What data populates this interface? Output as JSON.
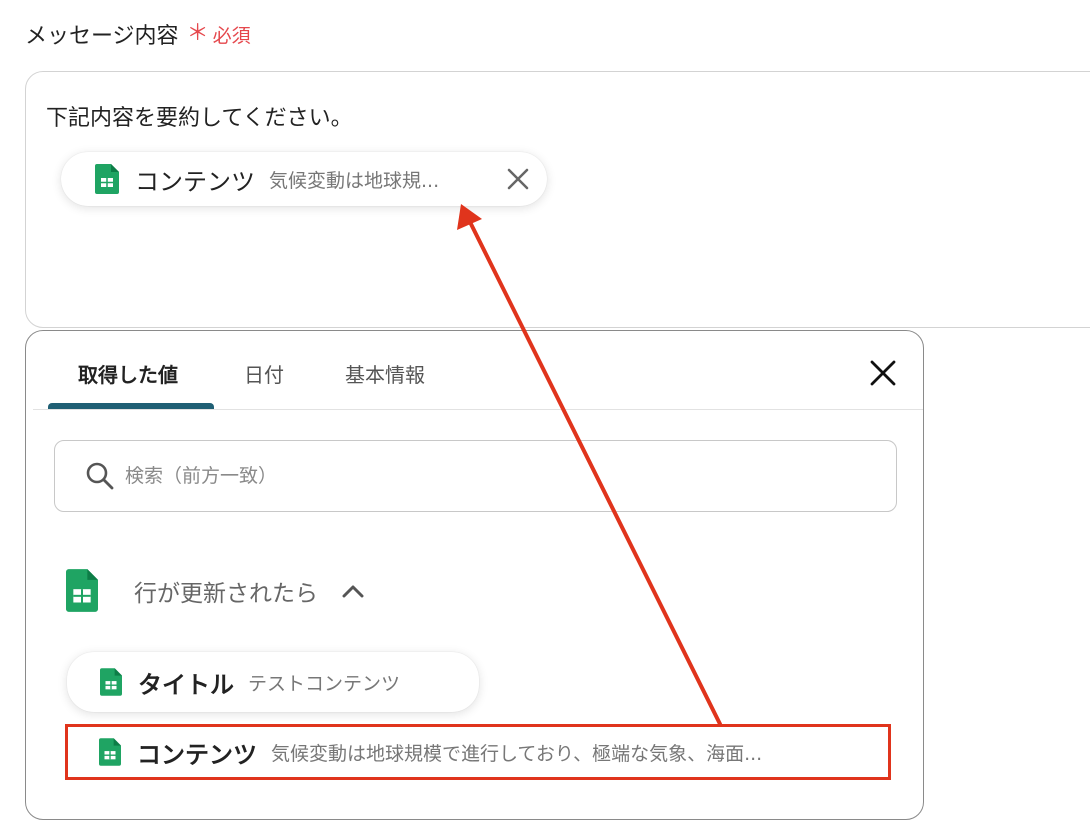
{
  "field": {
    "label": "メッセージ内容",
    "required_mark": "＊",
    "required_text": "必須"
  },
  "textarea": {
    "text": "下記内容を要約してください。",
    "chip": {
      "name": "コンテンツ",
      "value": "気候変動は地球規..."
    }
  },
  "panel": {
    "tabs": [
      {
        "label": "取得した値",
        "active": true
      },
      {
        "label": "日付",
        "active": false
      },
      {
        "label": "基本情報",
        "active": false
      }
    ],
    "search_placeholder": "検索（前方一致）",
    "section": {
      "title": "行が更新されたら",
      "items": [
        {
          "name": "タイトル",
          "value": "テストコンテンツ"
        },
        {
          "name": "コンテンツ",
          "value": "気候変動は地球規模で進行しており、極端な気象、海面..."
        }
      ]
    }
  },
  "icons": {
    "sheet": "google-sheets-icon",
    "close": "close-icon",
    "search": "search-icon",
    "chevron": "chevron-up-icon"
  },
  "colors": {
    "required": "#e5484d",
    "tab_indicator": "#1f5f74",
    "sheets_green": "#1fa463",
    "annotation_red": "#e0341c"
  }
}
